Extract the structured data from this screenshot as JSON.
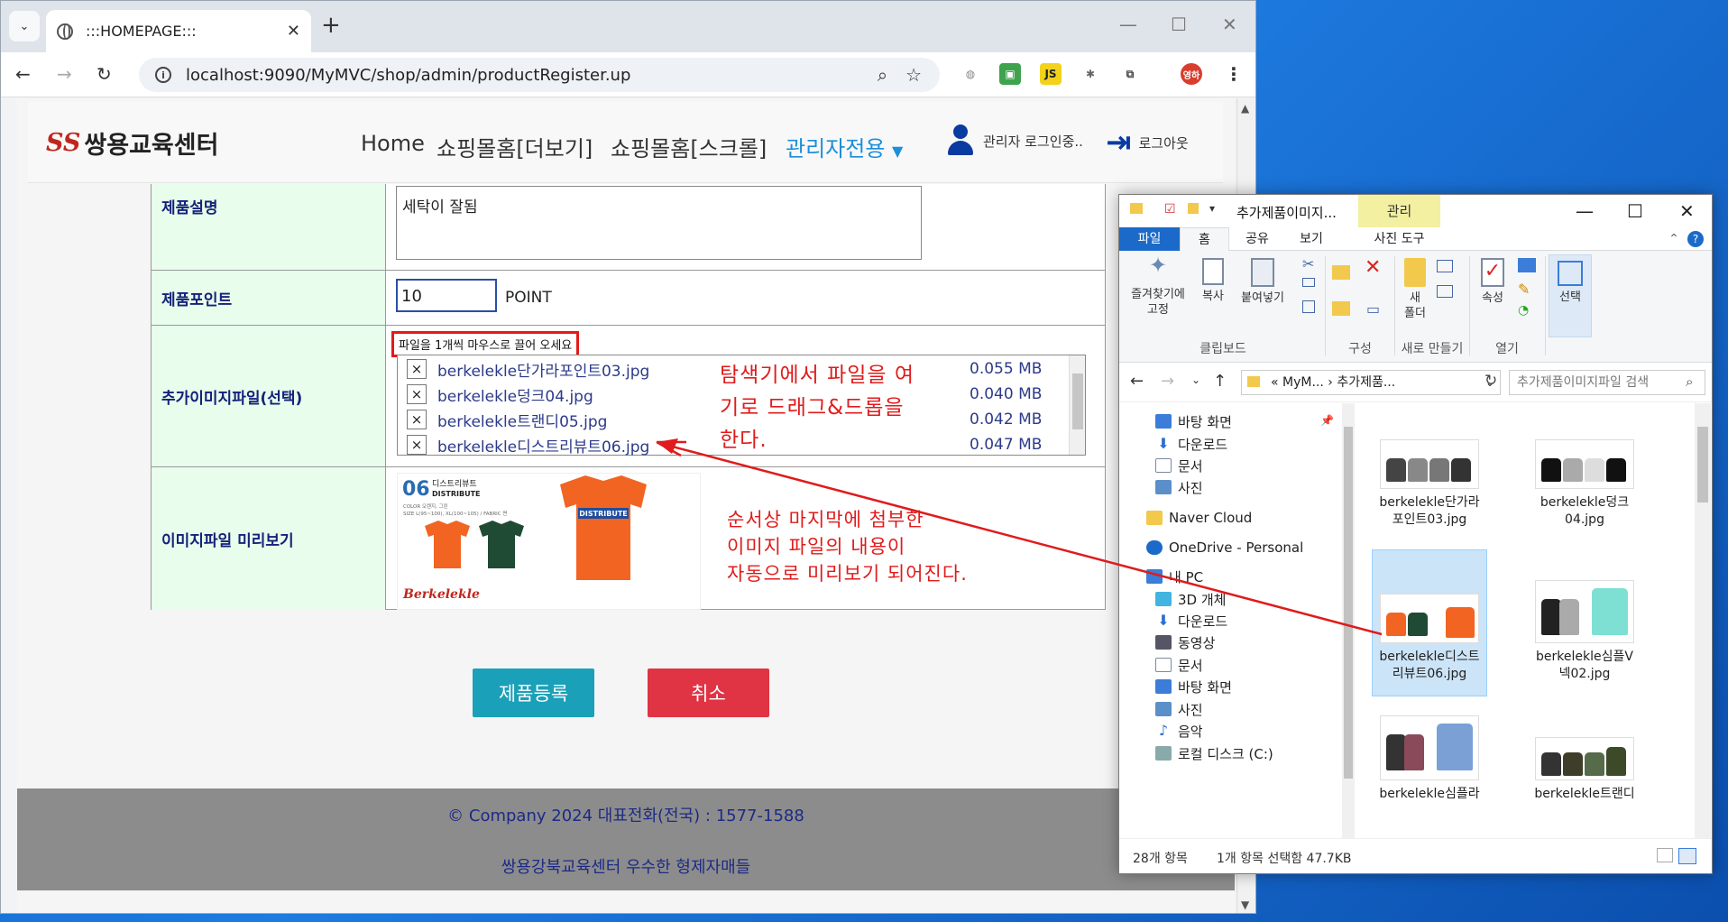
{
  "browser": {
    "tab_title": ":::HOMEPAGE:::",
    "url": "localhost:9090/MyMVC/shop/admin/productRegister.up",
    "ext_js": "JS",
    "profile": "영하"
  },
  "site": {
    "logo_mark": "SS",
    "logo_text": "쌍용교육센터",
    "menu": [
      "Home",
      "쇼핑몰홈[더보기]",
      "쇼핑몰홈[스크롤]",
      "관리자전용"
    ],
    "user_text": "관리자 로그인중..",
    "logout_text": "로그아웃"
  },
  "form": {
    "desc_label": "제품설명",
    "desc_value": "세탁이 잘됨",
    "point_label": "제품포인트",
    "point_value": "10",
    "point_unit": "POINT",
    "extra_label": "추가이미지파일(선택)",
    "drop_hint": "파일을 1개씩 마우스로 끌어 오세요",
    "files": [
      {
        "name": "berkelekle단가라포인트03.jpg",
        "size": "0.055 MB"
      },
      {
        "name": "berkelekle덩크04.jpg",
        "size": "0.040 MB"
      },
      {
        "name": "berkelekle트랜디05.jpg",
        "size": "0.042 MB"
      },
      {
        "name": "berkelekle디스트리뷰트06.jpg",
        "size": "0.047 MB"
      }
    ],
    "remove_glyph": "×",
    "preview_label": "이미지파일 미리보기",
    "preview": {
      "num": "06",
      "title_kr": "디스트리뷰트",
      "title_en": "DISTRIBUTE",
      "color": "COLOR 오렌지, 그린",
      "size": "SIZE L(95~100), XL(100~105) / FABRIC 면",
      "shirt_text": "DISTRIBUTE",
      "brand": "Berkelekle"
    },
    "register_label": "제품등록",
    "cancel_label": "취소"
  },
  "annotations": {
    "drag": [
      "탐색기에서 파일을 여",
      "기로 드래그&드롭을",
      "한다."
    ],
    "preview": [
      "순서상 마지막에 첨부한",
      "이미지 파일의 내용이",
      "자동으로 미리보기 되어진다."
    ]
  },
  "footer": {
    "line1": "© Company 2024    대표전화(전국) : 1577-1588",
    "line2": "쌍용강북교육센터 우수한 형제자매들"
  },
  "explorer": {
    "title": "추가제품이미지...",
    "manage_tab": "관리",
    "tabs": [
      "파일",
      "홈",
      "공유",
      "보기",
      "사진 도구"
    ],
    "ribbon": {
      "pin": [
        "즐겨찾기에",
        "고정"
      ],
      "copy": "복사",
      "paste": "붙여넣기",
      "new_folder": [
        "새",
        "폴더"
      ],
      "props": "속성",
      "select": "선택",
      "groups": [
        "클립보드",
        "구성",
        "새로 만들기",
        "열기"
      ]
    },
    "path": [
      "«  MyM...",
      "추가제품..."
    ],
    "search_placeholder": "추가제품이미지파일 검색",
    "tree": [
      "바탕 화면",
      "다운로드",
      "문서",
      "사진",
      "Naver Cloud",
      "OneDrive - Personal",
      "내 PC",
      "3D 개체",
      "다운로드",
      "동영상",
      "문서",
      "바탕 화면",
      "사진",
      "음악",
      "로컬 디스크 (C:)"
    ],
    "files": [
      [
        "berkelekle단가라",
        "포인트03.jpg"
      ],
      [
        "berkelekle덩크",
        "04.jpg"
      ],
      [
        "berkelekle디스트",
        "리뷰트06.jpg"
      ],
      [
        "berkelekle심플V",
        "넥02.jpg"
      ],
      [
        "berkelekle심플라",
        ""
      ],
      [
        "berkelekle트랜디",
        ""
      ]
    ],
    "status_count": "28개 항목",
    "status_sel": "1개 항목 선택함 47.7KB"
  },
  "colors": {
    "accent": "#1c8fd8",
    "register": "#1aa0b8",
    "cancel": "#e03444",
    "annotation": "#e01b1b",
    "label_bg": "#e8fdeb"
  }
}
